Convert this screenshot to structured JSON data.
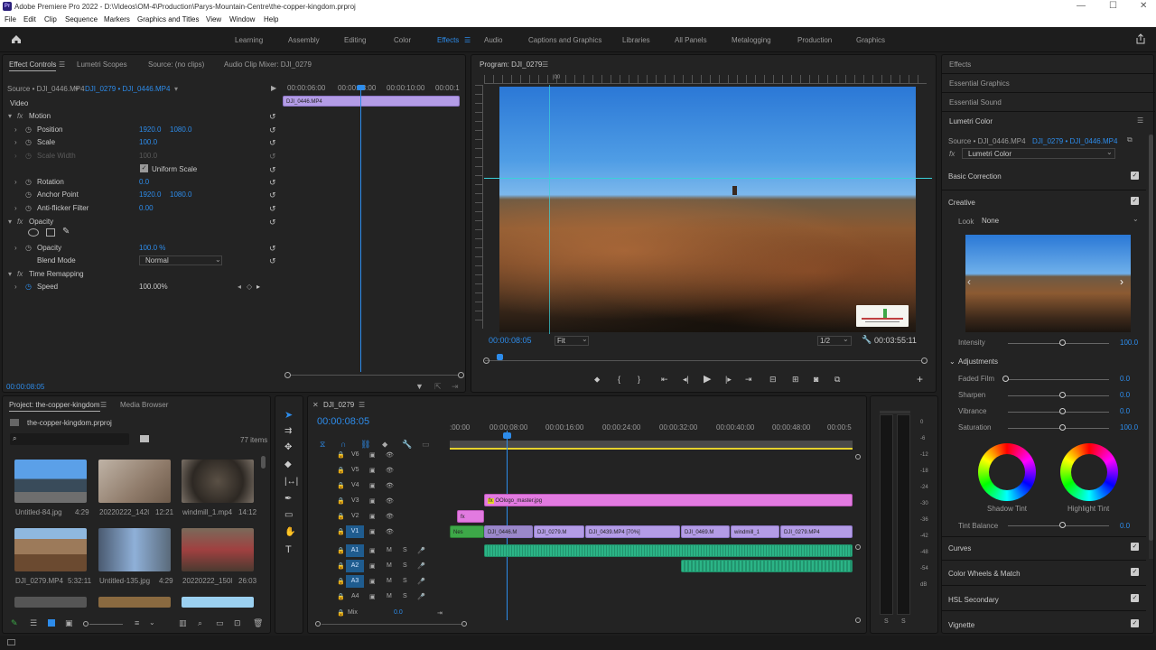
{
  "titlebar": {
    "logo": "Pr",
    "title": "Adobe Premiere Pro 2022 - D:\\Videos\\OM-4\\Production\\Parys-Mountain-Centre\\the-copper-kingdom.prproj",
    "min": "—",
    "max": "☐",
    "close": "✕"
  },
  "menu": [
    "File",
    "Edit",
    "Clip",
    "Sequence",
    "Markers",
    "Graphics and Titles",
    "View",
    "Window",
    "Help"
  ],
  "workspaces": [
    "Learning",
    "Assembly",
    "Editing",
    "Color",
    "Effects",
    "Audio",
    "Captions and Graphics",
    "Libraries",
    "All Panels",
    "Metalogging",
    "Production",
    "Graphics"
  ],
  "effect_controls": {
    "tabs": [
      "Effect Controls",
      "Lumetri Scopes",
      "Source: (no clips)",
      "Audio Clip Mixer: DJI_0279"
    ],
    "source": "Source • DJI_0446.MP4",
    "sequence": "DJI_0279 • DJI_0446.MP4",
    "timecodes": [
      "00:00:06:00",
      "00:00:08:00",
      "00:00:10:00",
      "00:00:1"
    ],
    "clip_label": "DJI_0446.MP4",
    "video": "Video",
    "motion": "Motion",
    "fx": "fx",
    "position_label": "Position",
    "position_x": "1920.0",
    "position_y": "1080.0",
    "scale_label": "Scale",
    "scale": "100.0",
    "scale_width_label": "Scale Width",
    "scale_width": "100.0",
    "uniform_scale": "Uniform Scale",
    "rotation_label": "Rotation",
    "rotation": "0.0",
    "anchor_label": "Anchor Point",
    "anchor_x": "1920.0",
    "anchor_y": "1080.0",
    "antiflicker_label": "Anti-flicker Filter",
    "antiflicker": "0.00",
    "opacity_group": "Opacity",
    "opacity_label": "Opacity",
    "opacity": "100.0 %",
    "blend_label": "Blend Mode",
    "blend": "Normal",
    "timeremap": "Time Remapping",
    "speed_label": "Speed",
    "speed": "100.00%",
    "current_time": "00:00:08:05"
  },
  "program": {
    "title": "Program: DJI_0279",
    "timecode": "00:00:08:05",
    "fit": "Fit",
    "res": "1/2",
    "duration": "00:03:55:11",
    "ruler_mark": "|00"
  },
  "project": {
    "tabs": [
      "Project: the-copper-kingdom",
      "Media Browser"
    ],
    "file": "the-copper-kingdom.prproj",
    "count": "77 items",
    "items": [
      {
        "name": "Untitled-84.jpg",
        "dur": "4:29"
      },
      {
        "name": "20220222_142058...",
        "dur": "12:21"
      },
      {
        "name": "windmill_1.mp4",
        "dur": "14:12"
      },
      {
        "name": "DJI_0279.MP4",
        "dur": "5:32:11"
      },
      {
        "name": "Untitled-135.jpg",
        "dur": "4:29"
      },
      {
        "name": "20220222_150828...",
        "dur": "26:03"
      }
    ]
  },
  "timeline": {
    "title": "DJI_0279",
    "timecode": "00:00:08:05",
    "ruler": [
      ":00:00",
      "00:00:08:00",
      "00:00:16:00",
      "00:00:24:00",
      "00:00:32:00",
      "00:00:40:00",
      "00:00:48:00",
      "00:00:5"
    ],
    "tracks_v": [
      "V6",
      "V5",
      "V4",
      "V3",
      "V2",
      "V1"
    ],
    "tracks_a": [
      "A1",
      "A2",
      "A3",
      "A4"
    ],
    "mix": "Mix",
    "mix_val": "0.0",
    "clips": {
      "logo": "OOlogo_master.jpg",
      "nest": "Nes",
      "c1": "DJI_0446.M",
      "c2": "DJI_0279.M",
      "c3": "DJI_0439.MP4 [70%]",
      "c4": "DJI_0469.M",
      "c5": "windmill_1",
      "c6": "DJI_0279.MP4",
      "fx": "fx"
    }
  },
  "meter": {
    "scale": [
      "0",
      "-6",
      "-12",
      "-18",
      "-24",
      "-30",
      "-36",
      "-42",
      "-48",
      "-54",
      "dB"
    ],
    "solo": [
      "S",
      "S"
    ]
  },
  "lumetri": {
    "panels": [
      "Effects",
      "Essential Graphics",
      "Essential Sound",
      "Lumetri Color"
    ],
    "source": "Source • DJI_0446.MP4",
    "sequence": "DJI_0279 • DJI_0446.MP4",
    "effect": "Lumetri Color",
    "fx": "fx",
    "basic": "Basic Correction",
    "creative": "Creative",
    "look_label": "Look",
    "look": "None",
    "intensity_label": "Intensity",
    "intensity": "100.0",
    "adjustments": "Adjustments",
    "sliders": [
      {
        "label": "Faded Film",
        "value": "0.0"
      },
      {
        "label": "Sharpen",
        "value": "0.0"
      },
      {
        "label": "Vibrance",
        "value": "0.0"
      },
      {
        "label": "Saturation",
        "value": "100.0"
      }
    ],
    "shadow_tint": "Shadow Tint",
    "highlight_tint": "Highlight Tint",
    "tint_balance_label": "Tint Balance",
    "tint_balance": "0.0",
    "sections": [
      "Curves",
      "Color Wheels & Match",
      "HSL Secondary",
      "Vignette"
    ]
  },
  "colors": {
    "accent": "#2d8ceb",
    "panel": "#232323",
    "bg": "#1d1d1d"
  }
}
